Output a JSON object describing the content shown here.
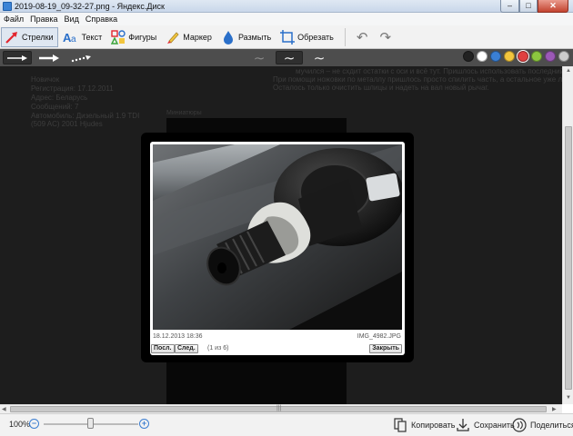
{
  "window": {
    "title": "2019-08-19_09-32-27.png - Яндекс.Диск",
    "controls": {
      "minimize": "–",
      "maximize": "□",
      "close": "✕"
    }
  },
  "menu": [
    "Файл",
    "Правка",
    "Вид",
    "Справка"
  ],
  "toolbar": {
    "tools": [
      {
        "label": "Стрелки",
        "icon": "arrow-tool-icon",
        "active": true
      },
      {
        "label": "Текст",
        "icon": "text-tool-icon",
        "active": false
      },
      {
        "label": "Фигуры",
        "icon": "shapes-tool-icon",
        "active": false
      },
      {
        "label": "Маркер",
        "icon": "marker-tool-icon",
        "active": false
      },
      {
        "label": "Размыть",
        "icon": "blur-tool-icon",
        "active": false
      },
      {
        "label": "Обрезать",
        "icon": "crop-tool-icon",
        "active": false
      }
    ],
    "undo_symbol": "↶",
    "redo_symbol": "↷"
  },
  "colors": [
    "#222222",
    "#ffffff",
    "#3a7fd5",
    "#f2c53d",
    "#e04040",
    "#8cc63f",
    "#9b59b6",
    "#cccccc"
  ],
  "selected_color": "#e04040",
  "wave_symbol": "∼",
  "background_page": {
    "body_lines": [
      "мучился – не схдит остатки с оси и всё тут. Пришлось использовать последний, радикальный метод.",
      "При помощи ножовки по металлу пришлось просто спилить часть, а остальное уже легко снялось.",
      "Осталось только очистить шлицы и надеть на вал новый рычаг."
    ],
    "profile_lines": [
      "Новичок",
      "Регистрация:   17.12.2011",
      "Адрес:           Беларусь",
      "Сообщений:    7",
      "Автомобиль:   Дизельный 1.9 TDI",
      "(509 AC) 2001 Hjudes"
    ],
    "thumbnails_label": "Миниатюры"
  },
  "lightbox": {
    "date": "18.12.2013 18:36",
    "filename": "IMG_4982.JPG",
    "prev_label": "Посл.",
    "next_label": "След.",
    "counter": "(1 из 6)",
    "close_label": "Закрыть"
  },
  "scroll_grip": "|||",
  "statusbar": {
    "zoom": "100%",
    "zoom_minus": "−",
    "zoom_plus": "+",
    "zoom_level": 0.5,
    "copy_label": "Копировать",
    "save_label": "Сохранить",
    "share_label": "Поделиться"
  }
}
